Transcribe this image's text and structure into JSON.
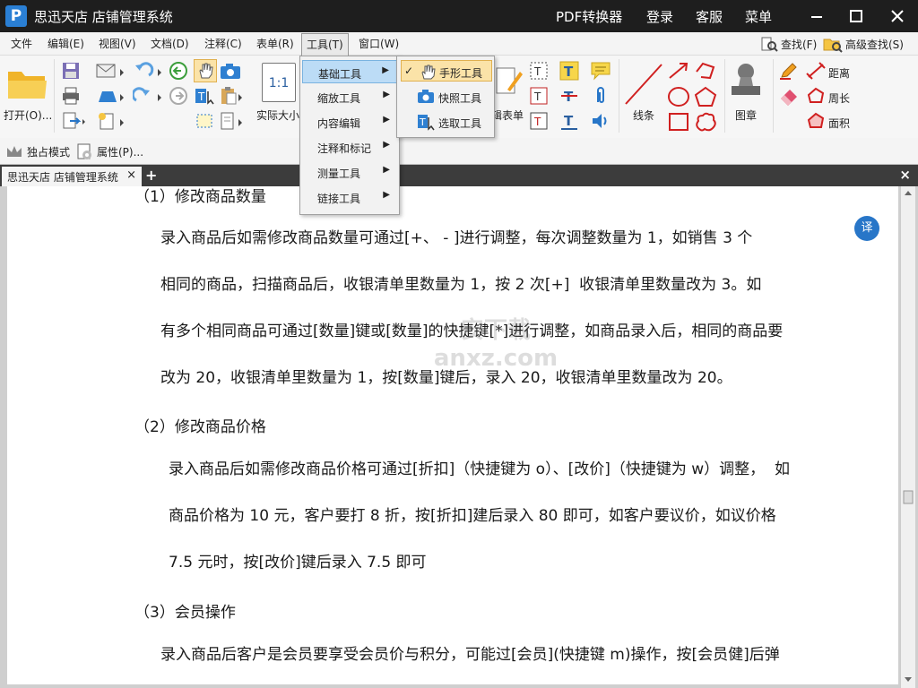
{
  "app": {
    "title": "思迅天店 店铺管理系统",
    "logo_letter": "P"
  },
  "titlebar": {
    "pdf_converter": "PDF转换器",
    "login": "登录",
    "service": "客服",
    "menu": "菜单"
  },
  "menubar": {
    "items": [
      "文件",
      "编辑(E)",
      "视图(V)",
      "文档(D)",
      "注释(C)",
      "表单(R)",
      "工具(T)",
      "窗口(W)"
    ],
    "find": "查找(F)",
    "advanced_find": "高级查找(S)"
  },
  "ribbon": {
    "open": "打开(O)...",
    "actual_size": "实际大小",
    "actual_size_glyph": "1:1",
    "form_edit": "编辑表单",
    "lines": "线条",
    "stamp": "图章",
    "distance": "距离",
    "perimeter": "周长",
    "area": "面积"
  },
  "subtoolbar": {
    "exclusive_mode": "独占模式",
    "properties": "属性(P)..."
  },
  "tabs": {
    "doc_tab": "思迅天店 店铺管理系统",
    "close": "×",
    "add": "+"
  },
  "tools_menu": {
    "items": [
      "基础工具",
      "缩放工具",
      "内容编辑",
      "注释和标记",
      "测量工具",
      "链接工具"
    ]
  },
  "basic_menu": {
    "items": [
      "手形工具",
      "快照工具",
      "选取工具"
    ],
    "checked_mark": "✓"
  },
  "document": {
    "heading1": "（1）修改商品数量",
    "para1": [
      "录入商品后如需修改商品数量可通过[+、 - ]进行调整，每次调整数量为 1，如销售 3 个",
      "相同的商品，扫描商品后，收银清单里数量为 1，按 2 次[+]  收银清单里数量改为 3。如",
      "有多个相同商品可通过[数量]键或[数量]的快捷键[*]进行调整，如商品录入后，相同的商品要",
      "改为 20，收银清单里数量为 1，按[数量]键后，录入 20，收银清单里数量改为 20。"
    ],
    "heading2": "（2）修改商品价格",
    "para2": [
      "录入商品后如需修改商品价格可通过[折扣]（快捷键为 o）、[改价]（快捷键为 w）调整，  如",
      "商品价格为 10 元，客户要打 8 折，按[折扣]建后录入 80 即可，如客户要议价，如议价格",
      "7.5 元时，按[改价]键后录入 7.5 即可"
    ],
    "heading3": "（3）会员操作",
    "para3": [
      "录入商品后客户是会员要享受会员价与积分，可能过[会员](快捷键 m)操作，按[会员健]后弹"
    ]
  },
  "translate_button": "译",
  "watermark": "安下载 anxz.com",
  "colors": {
    "titlebar_bg": "#1e1e1e",
    "accent": "#2876c8"
  }
}
